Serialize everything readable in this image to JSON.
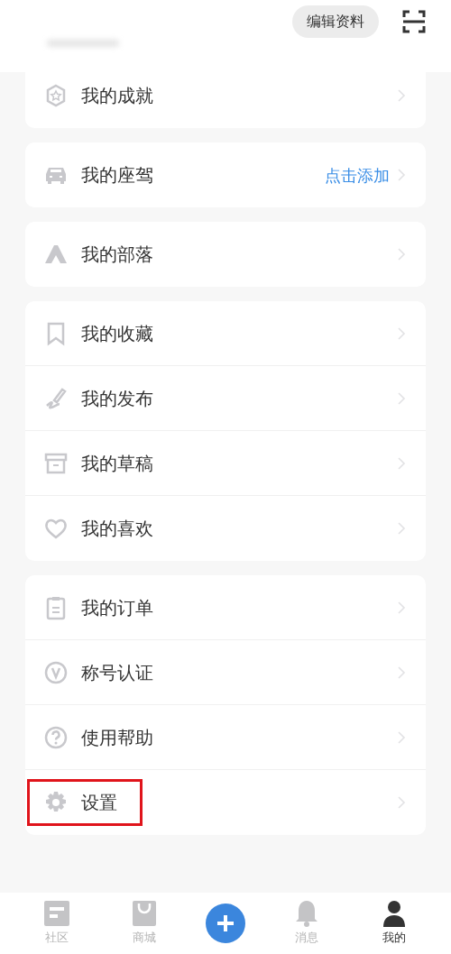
{
  "header": {
    "edit_button": "编辑资料"
  },
  "groups": [
    {
      "items": [
        {
          "kind": "achievement",
          "label": "我的成就",
          "highlighted": false
        }
      ]
    },
    {
      "items": [
        {
          "kind": "car",
          "label": "我的座驾",
          "value": "点击添加",
          "highlighted": false
        }
      ]
    },
    {
      "items": [
        {
          "kind": "tribe",
          "label": "我的部落",
          "highlighted": false
        }
      ]
    },
    {
      "items": [
        {
          "kind": "bookmark",
          "label": "我的收藏",
          "highlighted": false
        },
        {
          "kind": "publish",
          "label": "我的发布",
          "highlighted": false
        },
        {
          "kind": "draft",
          "label": "我的草稿",
          "highlighted": false
        },
        {
          "kind": "heart",
          "label": "我的喜欢",
          "highlighted": false
        }
      ]
    },
    {
      "items": [
        {
          "kind": "order",
          "label": "我的订单",
          "highlighted": false
        },
        {
          "kind": "title",
          "label": "称号认证",
          "highlighted": false
        },
        {
          "kind": "help",
          "label": "使用帮助",
          "highlighted": false
        },
        {
          "kind": "settings",
          "label": "设置",
          "highlighted": true
        }
      ]
    }
  ],
  "tab_bar": [
    {
      "kind": "community",
      "label": "社区",
      "selected": false
    },
    {
      "kind": "shop",
      "label": "商城",
      "selected": false
    },
    {
      "kind": "add"
    },
    {
      "kind": "messages",
      "label": "消息",
      "selected": false
    },
    {
      "kind": "me",
      "label": "我的",
      "selected": true
    }
  ]
}
